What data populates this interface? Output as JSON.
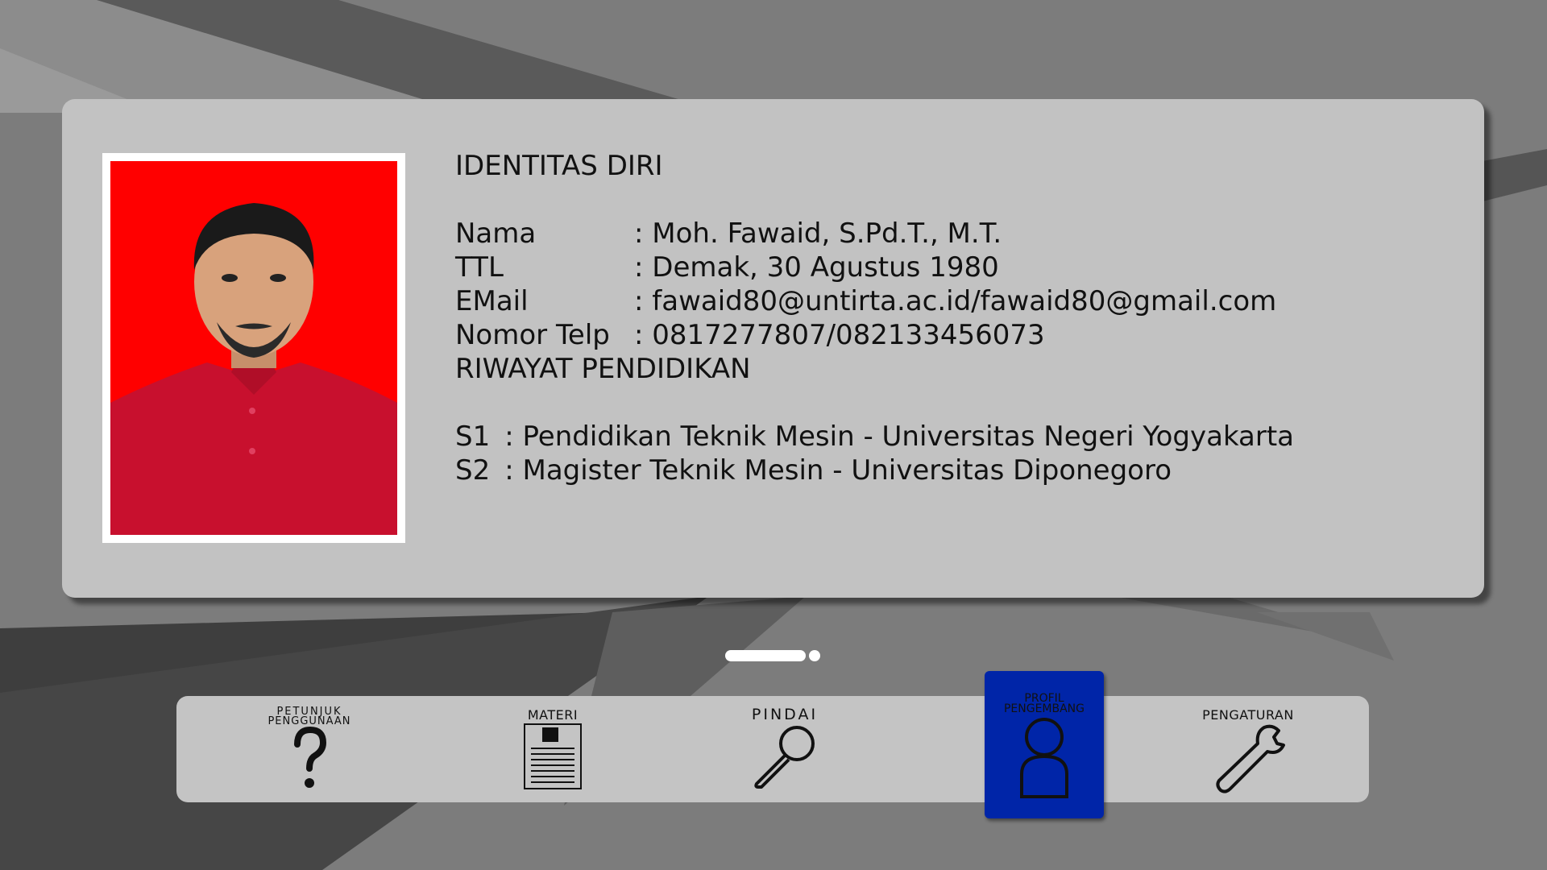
{
  "profile": {
    "identity_heading": "IDENTITAS DIRI",
    "fields": [
      {
        "label": "Nama",
        "value": ": Moh. Fawaid, S.Pd.T., M.T."
      },
      {
        "label": "TTL",
        "value": ": Demak, 30 Agustus 1980"
      },
      {
        "label": "EMail",
        "value": ": fawaid80@untirta.ac.id/fawaid80@gmail.com"
      },
      {
        "label": "Nomor Telp",
        "value": ": 0817277807/082133456073"
      }
    ],
    "education_heading": "RIWAYAT PENDIDIKAN",
    "education": [
      {
        "level": "S1",
        "value": ": Pendidikan Teknik Mesin - Universitas Negeri Yogyakarta"
      },
      {
        "level": "S2",
        "value": ": Magister Teknik Mesin - Universitas Diponegoro"
      }
    ]
  },
  "pager": {
    "pages": 2,
    "current": 1
  },
  "nav": {
    "items": [
      {
        "label_line1": "PETUNJUK",
        "label_line2": "PENGGUNAAN",
        "icon": "question-icon"
      },
      {
        "label": "MATERI",
        "icon": "document-icon"
      },
      {
        "label": "PINDAI",
        "icon": "magnifier-icon"
      },
      {
        "label_line1": "PROFIL",
        "label_line2": "PENGEMBANG",
        "icon": "person-icon",
        "active": true
      },
      {
        "label": "PENGATURAN",
        "icon": "wrench-icon"
      }
    ]
  },
  "colors": {
    "background": "#7c7c7c",
    "card": "#c2c2c2",
    "active_nav": "#0025a8",
    "photo_background": "#ff0000"
  }
}
